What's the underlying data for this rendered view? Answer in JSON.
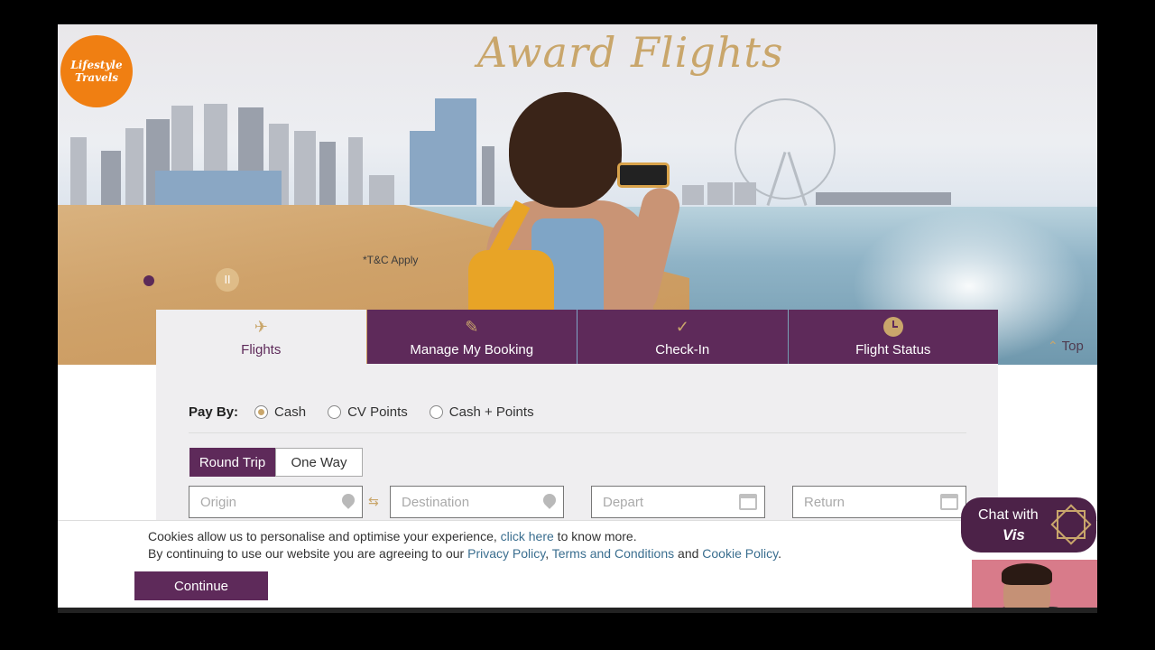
{
  "hero": {
    "logo_line1": "Lifestyle",
    "logo_line2": "Travels",
    "title": "Award Flights",
    "tc_note": "*T&C Apply",
    "pause_symbol": "II",
    "top_link": "Top"
  },
  "tabs": [
    {
      "label": "Flights",
      "icon": "plane-icon",
      "active": true
    },
    {
      "label": "Manage My Booking",
      "icon": "edit-icon",
      "active": false
    },
    {
      "label": "Check-In",
      "icon": "person-check-icon",
      "active": false
    },
    {
      "label": "Flight Status",
      "icon": "clock-icon",
      "active": false
    }
  ],
  "booking": {
    "pay_by_label": "Pay By:",
    "pay_options": [
      "Cash",
      "CV Points",
      "Cash + Points"
    ],
    "selected_pay": "Cash",
    "trip_types": [
      "Round Trip",
      "One Way"
    ],
    "selected_trip": "Round Trip",
    "origin_placeholder": "Origin",
    "destination_placeholder": "Destination",
    "depart_placeholder": "Depart",
    "return_placeholder": "Return"
  },
  "cookie": {
    "line1_pre": "Cookies allow us to personalise and optimise your experience, ",
    "line1_link": "click here",
    "line1_post": " to know more.",
    "line2_pre": "By continuing to use our website you are agreeing to our ",
    "privacy_link": "Privacy Policy",
    "sep": ", ",
    "terms_link": "Terms and Conditions",
    "and": " and ",
    "cookie_link": "Cookie Policy",
    "end": ".",
    "continue_label": "Continue"
  },
  "chat": {
    "line1": "Chat with",
    "line2": "Vis"
  },
  "colors": {
    "brand_purple": "#5e2a5a",
    "gold": "#c9a66b",
    "link_blue": "#3a6e8f"
  }
}
